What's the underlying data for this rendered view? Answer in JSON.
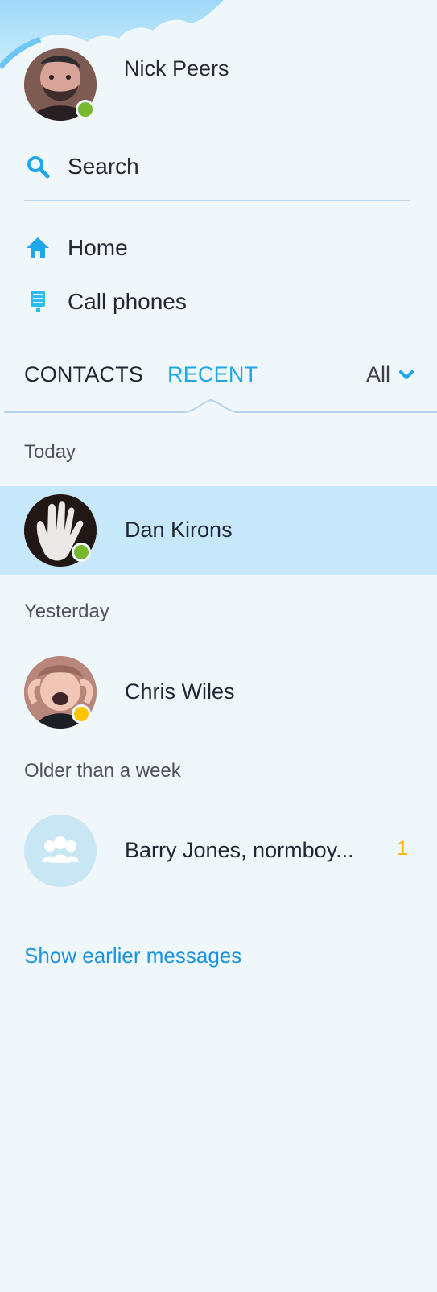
{
  "profile": {
    "name": "Nick Peers",
    "status": "online"
  },
  "navigation": {
    "search_label": "Search",
    "home_label": "Home",
    "call_phones_label": "Call phones"
  },
  "tabs": {
    "contacts_label": "CONTACTS",
    "recent_label": "RECENT",
    "filter_label": "All"
  },
  "sections": {
    "today": "Today",
    "yesterday": "Yesterday",
    "older": "Older than a week"
  },
  "conversations": [
    {
      "name": "Dan Kirons",
      "status": "online",
      "selected": true
    },
    {
      "name": "Chris Wiles",
      "status": "away",
      "selected": false
    },
    {
      "name": "Barry Jones, normboy...",
      "unread_count": "1",
      "type": "group"
    }
  ],
  "footer": {
    "show_earlier_label": "Show earlier messages"
  },
  "colors": {
    "accent": "#1ea7ea",
    "selected_row": "#c7e8fb",
    "online": "#77b82c",
    "away": "#ffc500",
    "unread": "#ffb400"
  },
  "icons": {
    "search": "search-icon",
    "home": "home-icon",
    "call_phones": "dialpad-icon",
    "filter": "chevron-down-icon",
    "group": "group-icon"
  }
}
